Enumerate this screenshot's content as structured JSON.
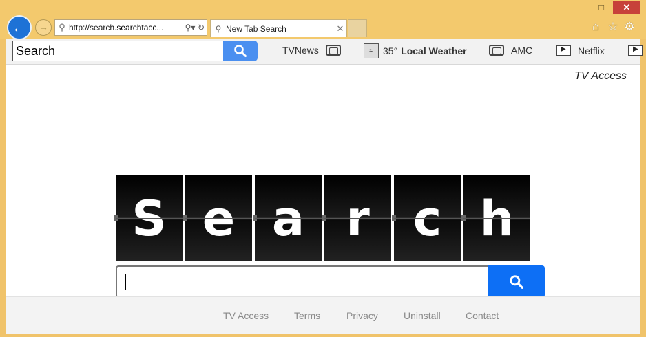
{
  "browser": {
    "address_url_prefix": "http://search.",
    "address_url_bold": "searchtacc...",
    "tab_title": "New Tab Search",
    "minimize_glyph": "–",
    "maximize_glyph": "□",
    "close_glyph": "✕"
  },
  "toolbar": {
    "search_value": "Search",
    "items": [
      {
        "label": "TVNews",
        "icon": "tv-icon"
      },
      {
        "temp": "35°",
        "label": "Local Weather",
        "icon": "weather-icon"
      },
      {
        "label": "AMC",
        "icon": "tv-icon"
      },
      {
        "label": "Netflix",
        "icon": "film-icon"
      }
    ]
  },
  "page": {
    "brand": "TV Access",
    "logo_letters": [
      "S",
      "e",
      "a",
      "r",
      "c",
      "h"
    ],
    "search_value": ""
  },
  "footer": {
    "links": [
      "TV Access",
      "Terms",
      "Privacy",
      "Uninstall",
      "Contact"
    ]
  },
  "colors": {
    "chrome": "#f3c96d",
    "accent_blue": "#0d6ff5",
    "toolbar_blue": "#4a8ff0"
  }
}
